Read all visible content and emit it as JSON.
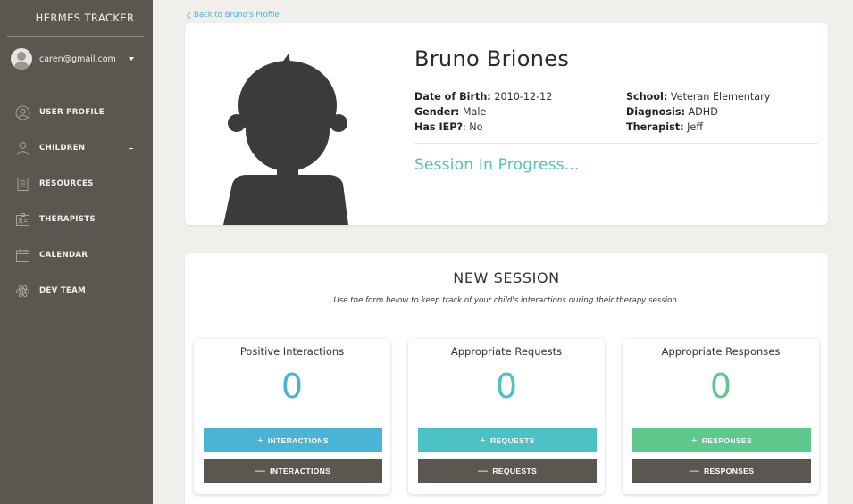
{
  "sidebar": {
    "brand": "HERMES TRACKER",
    "user_email": "caren@gmail.com",
    "items": [
      {
        "label": "USER PROFILE",
        "icon": "user-circle-icon"
      },
      {
        "label": "CHILDREN",
        "icon": "child-icon"
      },
      {
        "label": "RESOURCES",
        "icon": "document-icon"
      },
      {
        "label": "THERAPISTS",
        "icon": "id-badge-icon"
      },
      {
        "label": "CALENDAR",
        "icon": "calendar-icon"
      },
      {
        "label": "DEV TEAM",
        "icon": "atom-icon"
      }
    ]
  },
  "back_link": "Back to Bruno's Profile",
  "profile": {
    "name": "Bruno Briones",
    "dob_label": "Date of Birth:",
    "dob": " 2010-12-12",
    "gender_label": "Gender:",
    "gender": " Male",
    "iep_label": "Has IEP?",
    "iep": ": No",
    "school_label": "School:",
    "school": " Veteran Elementary",
    "diagnosis_label": "Diagnosis:",
    "diagnosis": " ADHD",
    "therapist_label": "Therapist:",
    "therapist": " Jeff",
    "status": "Session In Progress..."
  },
  "session": {
    "title": "NEW SESSION",
    "description": "Use the form below to keep track of your child's interactions during their therapy session.",
    "counters": [
      {
        "title": "Positive Interactions",
        "value": "0",
        "plus_label": "INTERACTIONS",
        "minus_label": "INTERACTIONS",
        "color": "#4ab3d6"
      },
      {
        "title": "Appropriate Requests",
        "value": "0",
        "plus_label": "REQUESTS",
        "minus_label": "REQUESTS",
        "color": "#4dc2c6"
      },
      {
        "title": "Appropriate Responses",
        "value": "0",
        "plus_label": "RESPONSES",
        "minus_label": "RESPONSES",
        "color": "#5fc98d"
      }
    ],
    "plus_symbol": "+",
    "minus_symbol": "—"
  },
  "colors": {
    "sidebar": "#5c5650",
    "accent_blue": "#4ab3d6",
    "accent_teal": "#4dc2c6",
    "accent_green": "#5fc98d",
    "background": "#f0efec"
  }
}
